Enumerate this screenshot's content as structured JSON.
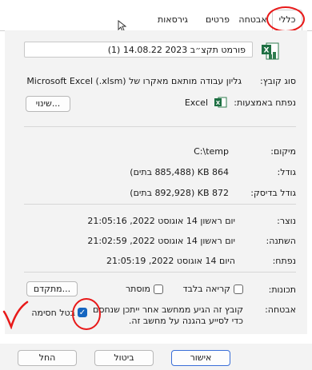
{
  "tabs": [
    {
      "label": "כללי"
    },
    {
      "label": "אבטחה"
    },
    {
      "label": "פרטים"
    },
    {
      "label": "גירסאות קודמות"
    }
  ],
  "file": {
    "name": "פורמט תקצ״ב 2023 14.08.22 (1)"
  },
  "labels": {
    "type": "סוג קובץ:",
    "opens_with": "נפתח באמצעות:",
    "location": "מיקום:",
    "size": "גודל:",
    "size_on_disk": "גודל בדיסק:",
    "created": "נוצר:",
    "modified": "השתנה:",
    "accessed": "נפתח:",
    "attributes": "תכונות:",
    "security": "אבטחה:"
  },
  "values": {
    "type": "גליון עבודה מותאם מאקרו של Microsoft Excel (.xlsm)",
    "opens_with": "Excel",
    "location": "C:\\temp",
    "size": "864 KB (885,488 בתים)",
    "size_on_disk": "872 KB (892,928 בתים)",
    "created": "יום ראשון 14 אוגוסט 2022, 21:05:16",
    "modified": "יום ראשון 14 אוגוסט 2022, 21:02:59",
    "accessed": "היום 14 אוגוסט 2022, 21:05:19",
    "security_text_1": "קובץ זה הגיע ממחשב אחר ייתכן שנחסם",
    "security_text_2": "כדי לסייע בהגנה על מחשב זה."
  },
  "buttons": {
    "change": "שינוי...",
    "advanced": "מתקדם...",
    "ok": "אישור",
    "cancel": "ביטול",
    "apply": "החל"
  },
  "checkboxes": {
    "readonly": "קריאה בלבד",
    "hidden": "מוסתר",
    "unblock": "בטל חסימה"
  }
}
